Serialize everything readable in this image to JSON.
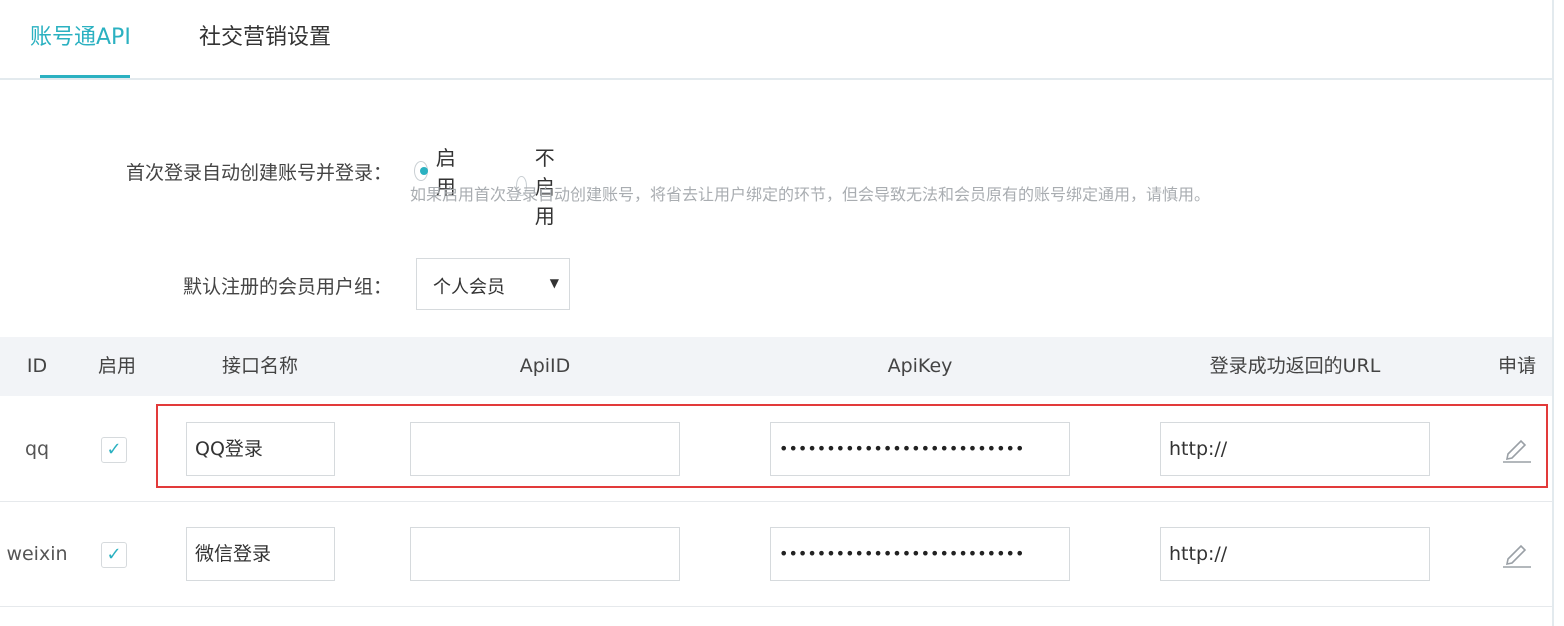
{
  "tabs": [
    {
      "label": "账号通API",
      "active": true
    },
    {
      "label": "社交营销设置",
      "active": false
    }
  ],
  "settings": {
    "auto_create_label": "首次登录自动创建账号并登录：",
    "radio_enable": "启用",
    "radio_disable": "不启用",
    "selected": "启用",
    "hint": "如果启用首次登录自动创建账号，将省去让用户绑定的环节，但会导致无法和会员原有的账号绑定通用，请慎用。",
    "default_group_label": "默认注册的会员用户组：",
    "default_group_value": "个人会员"
  },
  "table": {
    "headers": {
      "id": "ID",
      "enabled": "启用",
      "name": "接口名称",
      "api_id": "ApiID",
      "api_key": "ApiKey",
      "return_url": "登录成功返回的URL",
      "apply": "申请"
    },
    "rows": [
      {
        "id": "qq",
        "enabled": true,
        "name": "QQ登录",
        "api_id": "",
        "api_key": "••••••••••••••••••••••••••",
        "return_url": "http://"
      },
      {
        "id": "weixin",
        "enabled": true,
        "name": "微信登录",
        "api_id": "",
        "api_key": "••••••••••••••••••••••••••",
        "return_url": "http://"
      }
    ]
  },
  "colors": {
    "accent": "#2bb1c1",
    "highlight": "#e23a3a"
  },
  "icons": {
    "edit": "pencil-icon",
    "check": "checkmark-icon",
    "caret": "caret-down-icon"
  }
}
